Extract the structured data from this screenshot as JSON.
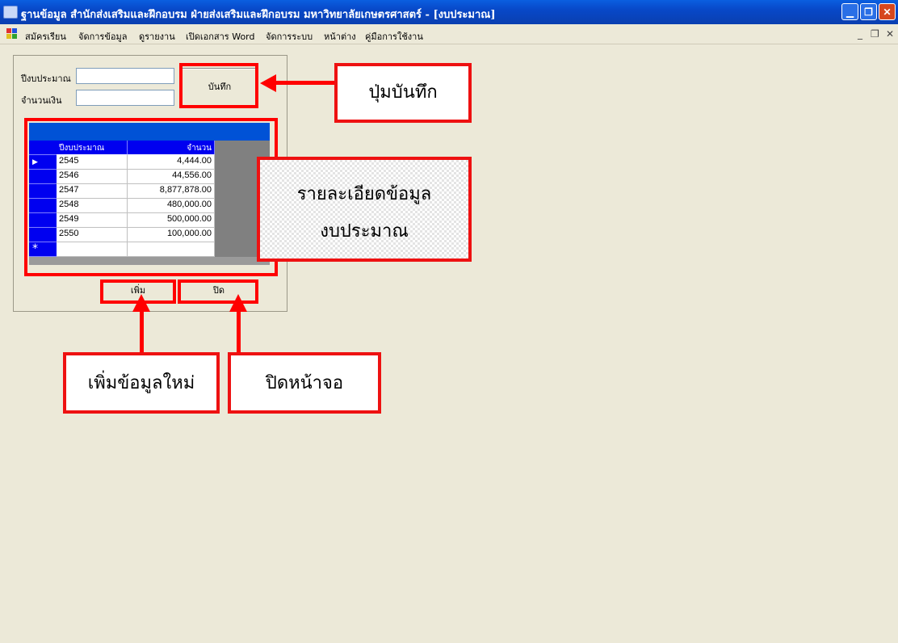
{
  "window": {
    "title": "ฐานข้อมูล สำนักส่งเสริมและฝึกอบรม ฝ่ายส่งเสริมและฝึกอบรม มหาวิทยาลัยเกษตรศาสตร์ - [งบประมาณ]"
  },
  "menu": {
    "items": [
      "สมัครเรียน",
      "จัดการข้อมูล",
      "ดูรายงาน",
      "เปิดเอกสาร Word",
      "จัดการระบบ",
      "หน้าต่าง",
      "คู่มือการใช้งาน"
    ]
  },
  "form": {
    "year_label": "ปีงบประมาณ",
    "amount_label": "จำนวนเงิน",
    "year_value": "",
    "amount_value": "",
    "save_label": "บันทึก",
    "add_label": "เพิ่ม",
    "close_label": "ปิด"
  },
  "grid": {
    "columns": [
      "ปีงบประมาณ",
      "จำนวน"
    ],
    "rows": [
      {
        "year": "2545",
        "amount": "4,444.00"
      },
      {
        "year": "2546",
        "amount": "44,556.00"
      },
      {
        "year": "2547",
        "amount": "8,877,878.00"
      },
      {
        "year": "2548",
        "amount": "480,000.00"
      },
      {
        "year": "2549",
        "amount": "500,000.00"
      },
      {
        "year": "2550",
        "amount": "100,000.00"
      }
    ],
    "new_row_marker": "*",
    "current_row_marker": "▶"
  },
  "annotations": {
    "save_callout": "ปุ่มบันทึก",
    "detail_line1": "รายละเอียดข้อมูล",
    "detail_line2": "งบประมาณ",
    "add_callout": "เพิ่มข้อมูลใหม่",
    "close_callout": "ปิดหน้าจอ"
  },
  "colors": {
    "annotation_red": "#ff0000",
    "titlebar_blue": "#0848c8",
    "grid_selector_blue": "#0000f0"
  }
}
